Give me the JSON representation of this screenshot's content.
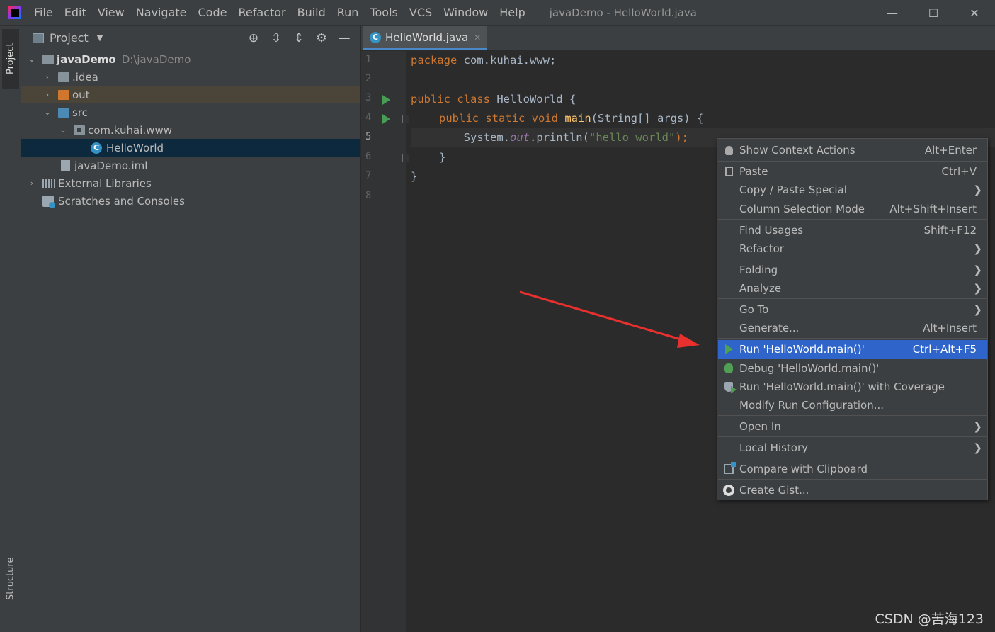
{
  "menu": [
    "File",
    "Edit",
    "View",
    "Navigate",
    "Code",
    "Refactor",
    "Build",
    "Run",
    "Tools",
    "VCS",
    "Window",
    "Help"
  ],
  "window_title": "javaDemo - HelloWorld.java",
  "window_controls": {
    "minimize": "—",
    "maximize": "☐",
    "close": "✕"
  },
  "left_strip": {
    "project_tab": "Project",
    "structure_tab": "Structure"
  },
  "project_panel": {
    "title": "Project",
    "tree": [
      {
        "label": "javaDemo",
        "path": "D:\\javaDemo"
      },
      {
        "label": ".idea"
      },
      {
        "label": "out"
      },
      {
        "label": "src"
      },
      {
        "label": "com.kuhai.www"
      },
      {
        "label": "HelloWorld"
      },
      {
        "label": "javaDemo.iml"
      },
      {
        "label": "External Libraries"
      },
      {
        "label": "Scratches and Consoles"
      }
    ]
  },
  "editor": {
    "tab_label": "HelloWorld.java",
    "line_numbers": [
      "1",
      "2",
      "3",
      "4",
      "5",
      "6",
      "7",
      "8"
    ],
    "code": {
      "l1_kw": "package",
      "l1_rest": " com.kuhai.www;",
      "l3_kw": "public class",
      "l3_rest": " HelloWorld {",
      "l4_kw": "public static void",
      "l4_fn": "main",
      "l4_rest": "(String[] args) {",
      "l5_a": "System.",
      "l5_field": "out",
      "l5_b": ".println(",
      "l5_str": "\"hello world\"",
      "l5_c": ");",
      "l6": "}",
      "l7": "}"
    }
  },
  "context_menu": {
    "items": [
      {
        "label": "Show Context Actions",
        "shortcut": "Alt+Enter",
        "icon": "bulb-icon"
      },
      {
        "label": "Paste",
        "shortcut": "Ctrl+V",
        "icon": "paste-icon"
      },
      {
        "label": "Copy / Paste Special",
        "submenu": "❯"
      },
      {
        "label": "Column Selection Mode",
        "shortcut": "Alt+Shift+Insert"
      },
      {
        "label": "Find Usages",
        "shortcut": "Shift+F12"
      },
      {
        "label": "Refactor",
        "submenu": "❯"
      },
      {
        "label": "Folding",
        "submenu": "❯"
      },
      {
        "label": "Analyze",
        "submenu": "❯"
      },
      {
        "label": "Go To",
        "submenu": "❯"
      },
      {
        "label": "Generate...",
        "shortcut": "Alt+Insert"
      },
      {
        "label": "Run 'HelloWorld.main()'",
        "shortcut": "Ctrl+Alt+F5",
        "icon": "run-icon"
      },
      {
        "label": "Debug 'HelloWorld.main()'",
        "icon": "debug-icon"
      },
      {
        "label": "Run 'HelloWorld.main()' with Coverage",
        "icon": "coverage-icon"
      },
      {
        "label": "Modify Run Configuration..."
      },
      {
        "label": "Open In",
        "submenu": "❯"
      },
      {
        "label": "Local History",
        "submenu": "❯"
      },
      {
        "label": "Compare with Clipboard",
        "icon": "compare-icon"
      },
      {
        "label": "Create Gist...",
        "icon": "github-icon"
      }
    ]
  },
  "watermark": "CSDN @苦海123",
  "colors": {
    "accent": "#2f65ca",
    "annotation_arrow": "#e8312e",
    "run_green": "#499c54"
  }
}
